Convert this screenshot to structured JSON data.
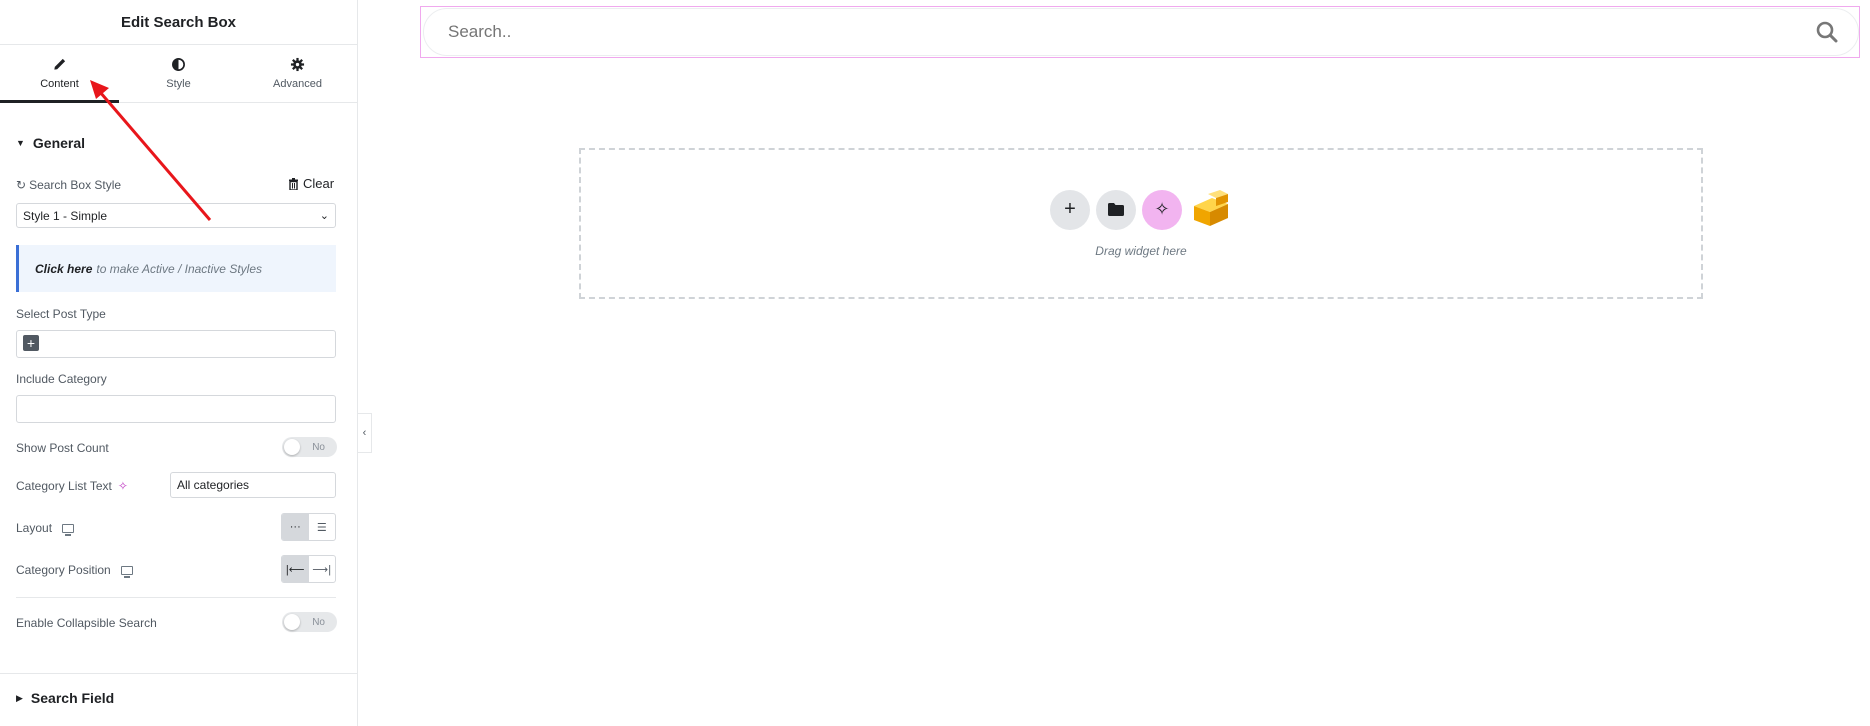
{
  "panel": {
    "title": "Edit Search Box",
    "tabs": [
      {
        "label": "Content",
        "icon": "pencil-icon"
      },
      {
        "label": "Style",
        "icon": "contrast-icon"
      },
      {
        "label": "Advanced",
        "icon": "gear-icon"
      }
    ],
    "general": {
      "heading": "General",
      "search_box_style_label": "Search Box Style",
      "clear_label": "Clear",
      "search_box_style_value": "Style 1 - Simple",
      "info_link": "Click here",
      "info_text": "to make Active / Inactive Styles",
      "select_post_type_label": "Select Post Type",
      "include_category_label": "Include Category",
      "show_post_count_label": "Show Post Count",
      "show_post_count_value": "No",
      "category_list_text_label": "Category List Text",
      "category_list_text_value": "All categories",
      "layout_label": "Layout",
      "category_position_label": "Category Position",
      "enable_collapsible_label": "Enable Collapsible Search",
      "enable_collapsible_value": "No"
    },
    "search_field_heading": "Search Field"
  },
  "canvas": {
    "search_placeholder": "Search..",
    "drop_text": "Drag widget here"
  },
  "colors": {
    "accent_pink": "#f0a9ee",
    "info_border": "#3a6fd6",
    "arrow_red": "#e8161b"
  }
}
